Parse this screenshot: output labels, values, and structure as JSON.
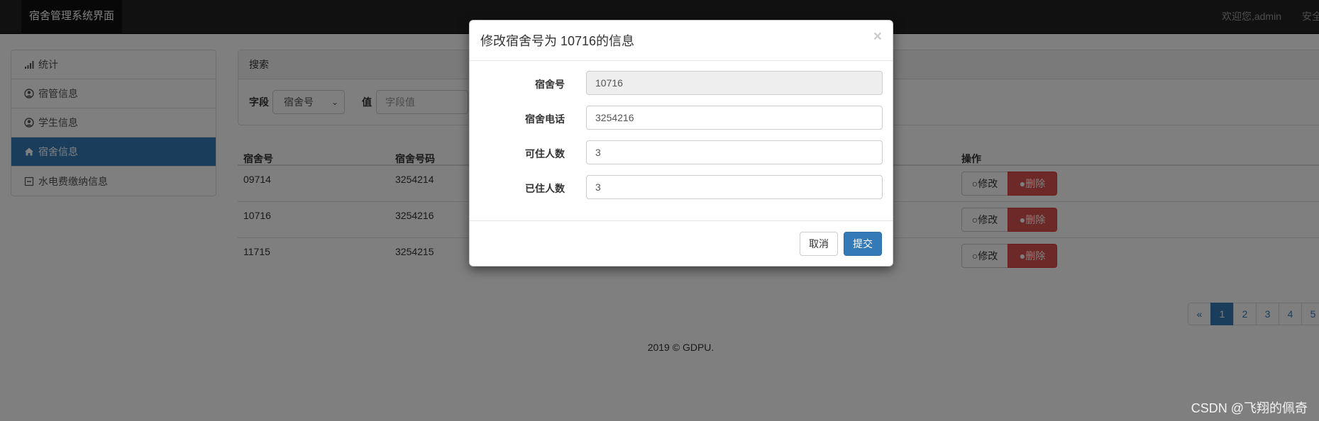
{
  "nav": {
    "brand": "宿舍管理系统界面",
    "welcome": "欢迎您,admin",
    "safe_link": "安全"
  },
  "sidebar": {
    "items": [
      {
        "label": "统计",
        "icon": "signal-icon"
      },
      {
        "label": "宿管信息",
        "icon": "user-circle-icon"
      },
      {
        "label": "学生信息",
        "icon": "user-circle-icon"
      },
      {
        "label": "宿舍信息",
        "icon": "home-icon",
        "active": true
      },
      {
        "label": "水电费缴纳信息",
        "icon": "minus-square-icon"
      }
    ]
  },
  "search": {
    "panel_title": "搜索",
    "field_label": "字段",
    "field_selected": "宿舍号",
    "value_label": "值",
    "value_placeholder": "字段值"
  },
  "table": {
    "headers": [
      "宿舍号",
      "宿舍号码",
      "操作"
    ],
    "rows": [
      {
        "id": "09714",
        "phone": "3254214"
      },
      {
        "id": "10716",
        "phone": "3254216"
      },
      {
        "id": "11715",
        "phone": "3254215"
      }
    ],
    "edit_label": "修改",
    "delete_label": "删除"
  },
  "pagination": {
    "prev": "«",
    "pages": [
      "1",
      "2",
      "3",
      "4",
      "5"
    ],
    "current": "1"
  },
  "footer": {
    "text": "2019 © GDPU."
  },
  "modal": {
    "title": "修改宿舍号为 10716的信息",
    "close": "×",
    "fields": [
      {
        "label": "宿舍号",
        "value": "10716",
        "disabled": true
      },
      {
        "label": "宿舍电话",
        "value": "3254216"
      },
      {
        "label": "可住人数",
        "value": "3"
      },
      {
        "label": "已住人数",
        "value": "3"
      }
    ],
    "cancel_label": "取消",
    "submit_label": "提交"
  },
  "watermark": "CSDN @飞翔的佩奇",
  "colors": {
    "primary": "#337ab7",
    "danger": "#d9534f",
    "navbar": "#222222"
  }
}
